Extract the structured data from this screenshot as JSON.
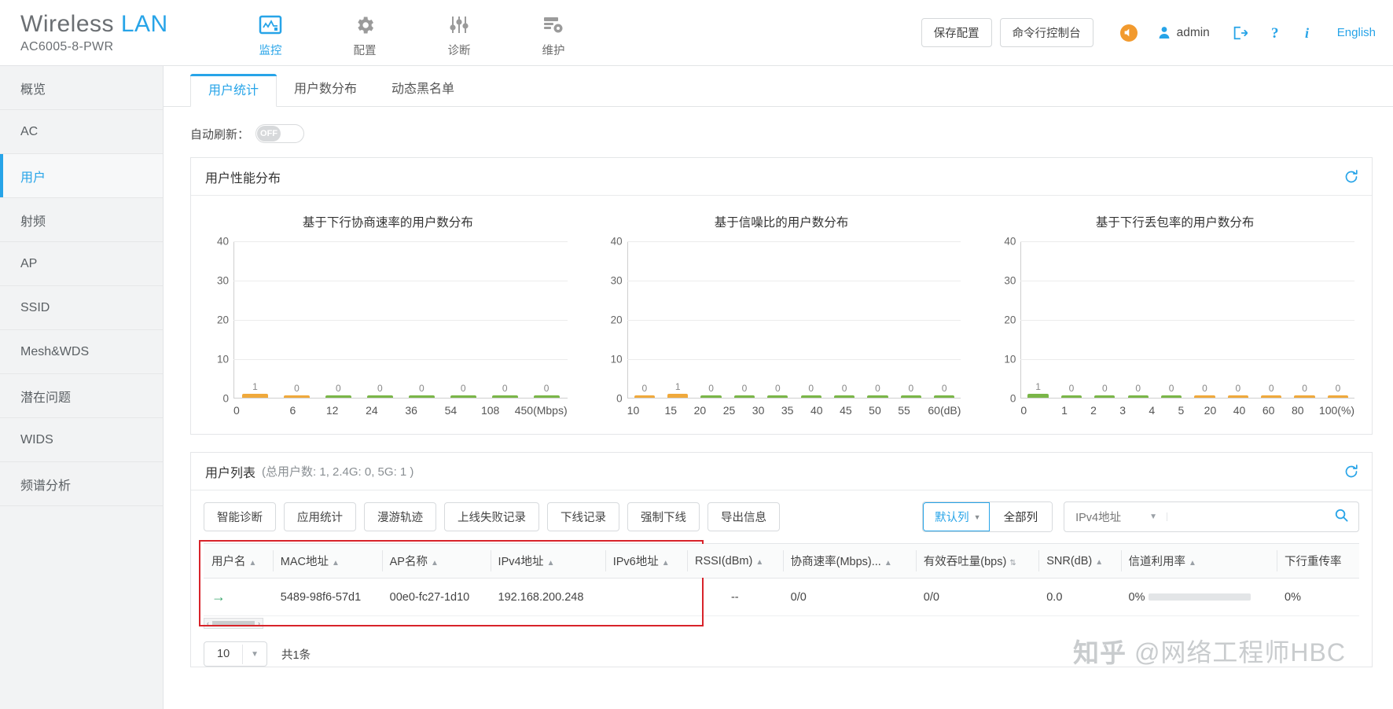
{
  "header": {
    "brand_primary": "Wireless",
    "brand_accent": "LAN",
    "model": "AC6005-8-PWR",
    "nav": [
      {
        "label": "监控",
        "icon": "monitor-icon",
        "active": true
      },
      {
        "label": "配置",
        "icon": "gear-icon",
        "active": false
      },
      {
        "label": "诊断",
        "icon": "sliders-icon",
        "active": false
      },
      {
        "label": "维护",
        "icon": "maintenance-icon",
        "active": false
      }
    ],
    "save_config_label": "保存配置",
    "cli_console_label": "命令行控制台",
    "user_name": "admin",
    "language_label": "English",
    "icons": [
      "speaker-icon",
      "user-icon",
      "logout-icon",
      "help-icon",
      "info-icon"
    ]
  },
  "sidebar": {
    "items": [
      {
        "label": "概览",
        "active": false
      },
      {
        "label": "AC",
        "active": false
      },
      {
        "label": "用户",
        "active": true
      },
      {
        "label": "射频",
        "active": false
      },
      {
        "label": "AP",
        "active": false
      },
      {
        "label": "SSID",
        "active": false
      },
      {
        "label": "Mesh&WDS",
        "active": false
      },
      {
        "label": "潜在问题",
        "active": false
      },
      {
        "label": "WIDS",
        "active": false
      },
      {
        "label": "频谱分析",
        "active": false
      }
    ]
  },
  "tabs": [
    {
      "label": "用户统计",
      "active": true
    },
    {
      "label": "用户数分布",
      "active": false
    },
    {
      "label": "动态黑名单",
      "active": false
    }
  ],
  "auto_refresh": {
    "label": "自动刷新：",
    "state": "OFF"
  },
  "perf_panel": {
    "title": "用户性能分布",
    "refresh_icon": "refresh-icon"
  },
  "chart_data": [
    {
      "type": "bar",
      "title": "基于下行协商速率的用户数分布",
      "categories": [
        "0",
        "6",
        "12",
        "24",
        "36",
        "54",
        "108",
        "450"
      ],
      "values": [
        1,
        0,
        0,
        0,
        0,
        0,
        0,
        0
      ],
      "colors": [
        "#f0a93c",
        "#f0a93c",
        "#7ab648",
        "#7ab648",
        "#7ab648",
        "#7ab648",
        "#7ab648",
        "#7ab648"
      ],
      "xunit": "(Mbps)",
      "xlabel": "",
      "ylabel": "",
      "yticks": [
        0,
        10,
        20,
        30,
        40
      ],
      "ylim": [
        0,
        40
      ],
      "grid": true
    },
    {
      "type": "bar",
      "title": "基于信噪比的用户数分布",
      "categories": [
        "10",
        "15",
        "20",
        "25",
        "30",
        "35",
        "40",
        "45",
        "50",
        "55",
        "60"
      ],
      "values": [
        0,
        1,
        0,
        0,
        0,
        0,
        0,
        0,
        0,
        0
      ],
      "colors": [
        "#f0a93c",
        "#f0a93c",
        "#7ab648",
        "#7ab648",
        "#7ab648",
        "#7ab648",
        "#7ab648",
        "#7ab648",
        "#7ab648",
        "#7ab648"
      ],
      "xunit": "(dB)",
      "xlabel": "",
      "ylabel": "",
      "yticks": [
        0,
        10,
        20,
        30,
        40
      ],
      "ylim": [
        0,
        40
      ],
      "grid": true
    },
    {
      "type": "bar",
      "title": "基于下行丢包率的用户数分布",
      "categories": [
        "0",
        "1",
        "2",
        "3",
        "4",
        "5",
        "20",
        "40",
        "60",
        "80",
        "100"
      ],
      "values": [
        1,
        0,
        0,
        0,
        0,
        0,
        0,
        0,
        0,
        0
      ],
      "colors": [
        "#7ab648",
        "#7ab648",
        "#7ab648",
        "#7ab648",
        "#7ab648",
        "#f0a93c",
        "#f0a93c",
        "#f0a93c",
        "#f0a93c",
        "#f0a93c"
      ],
      "xunit": "(%)",
      "xlabel": "",
      "ylabel": "",
      "yticks": [
        0,
        10,
        20,
        30,
        40
      ],
      "ylim": [
        0,
        40
      ],
      "grid": true
    }
  ],
  "user_list": {
    "title": "用户列表",
    "subtitle": "(总用户数: 1,  2.4G: 0,  5G: 1 )",
    "refresh_icon": "refresh-icon",
    "buttons": [
      "智能诊断",
      "应用统计",
      "漫游轨迹",
      "上线失败记录",
      "下线记录",
      "强制下线",
      "导出信息"
    ],
    "column_toggle": {
      "default_label": "默认列",
      "all_label": "全部列"
    },
    "search": {
      "field_label": "IPv4地址",
      "value": "",
      "placeholder": "",
      "icon": "search-icon"
    },
    "columns": [
      "用户名",
      "MAC地址",
      "AP名称",
      "IPv4地址",
      "IPv6地址",
      "RSSI(dBm)",
      "协商速率(Mbps)...",
      "有效吞吐量(bps)",
      "SNR(dB)",
      "信道利用率",
      "下行重传率"
    ],
    "rows": [
      {
        "expand_icon": "arrow-right-icon",
        "user_name": "",
        "mac": "5489-98f6-57d1",
        "ap_name": "00e0-fc27-1d10",
        "ipv4": "192.168.200.248",
        "ipv6": "",
        "rssi": "--",
        "rate": "0/0",
        "throughput": "0/0",
        "snr": "0.0",
        "channel_util": "0%",
        "retrans": "0%"
      }
    ],
    "page_size": "10",
    "total_text": "共1条"
  },
  "watermark": {
    "site": "知乎",
    "author": "@网络工程师HBC"
  }
}
